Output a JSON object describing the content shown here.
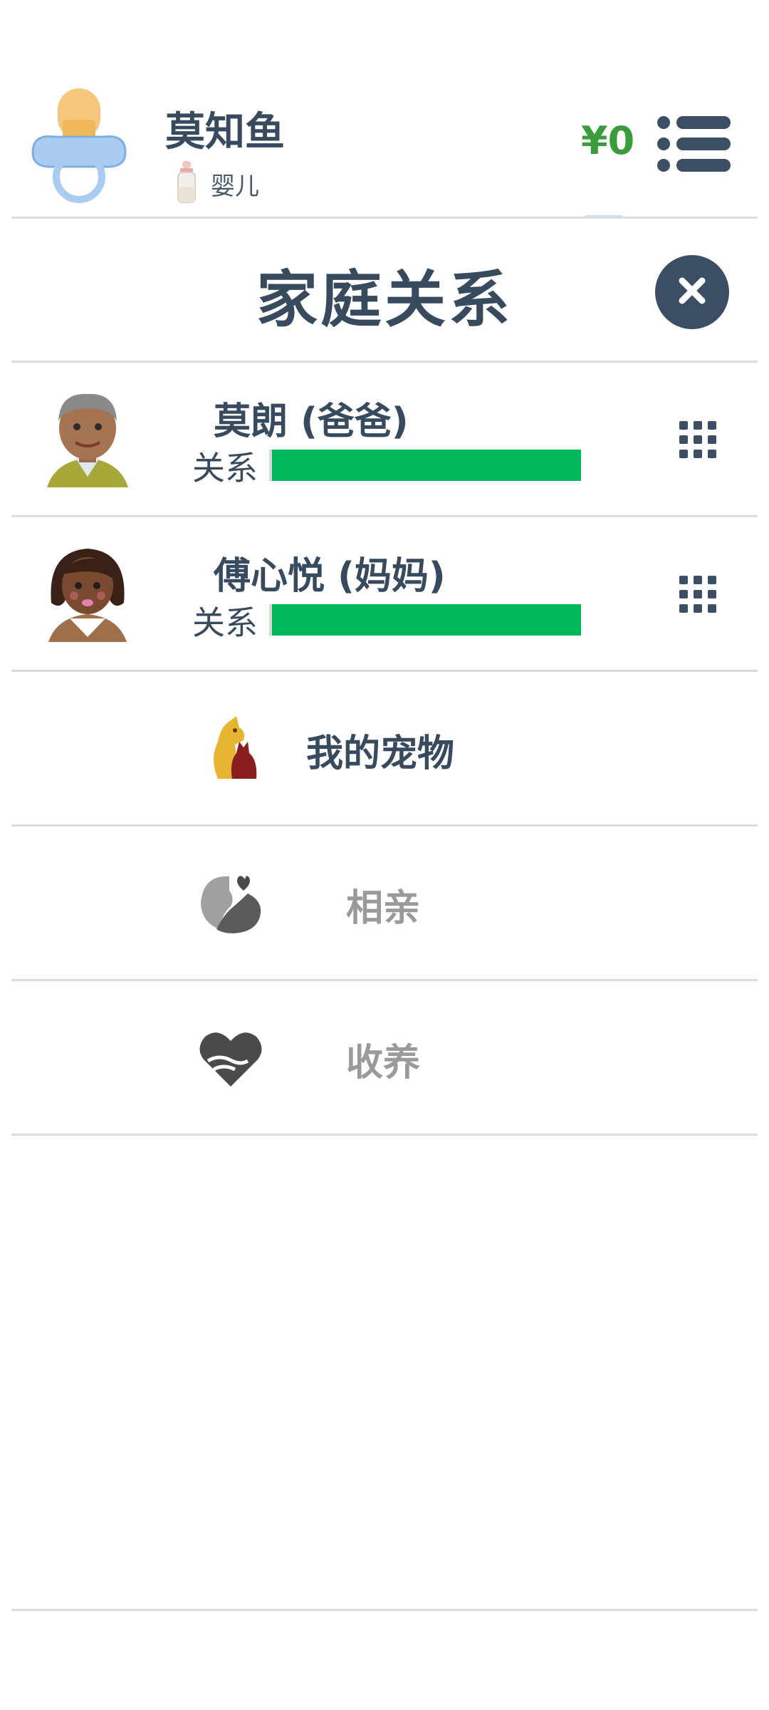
{
  "header": {
    "player_name": "莫知鱼",
    "life_stage": "婴儿",
    "money": "¥0"
  },
  "panel": {
    "title": "家庭关系"
  },
  "relations": [
    {
      "name": "莫朗 (爸爸)",
      "label": "关系",
      "level_percent": 100,
      "avatar": "father-avatar"
    },
    {
      "name": "傅心悦 (妈妈)",
      "label": "关系",
      "level_percent": 100,
      "avatar": "mother-avatar"
    }
  ],
  "menu": {
    "pets": "我的宠物",
    "dating": "相亲",
    "adopt": "收养"
  },
  "colors": {
    "primary": "#374a5e",
    "money": "#3a9c3a",
    "relation_bar": "#00b85a",
    "muted": "#9a9a9a"
  },
  "icons": [
    "pacifier-icon",
    "baby-bottle-icon",
    "menu-list-icon",
    "close-icon",
    "grid-menu-icon",
    "pet-icon",
    "dating-icon",
    "adopt-icon"
  ]
}
